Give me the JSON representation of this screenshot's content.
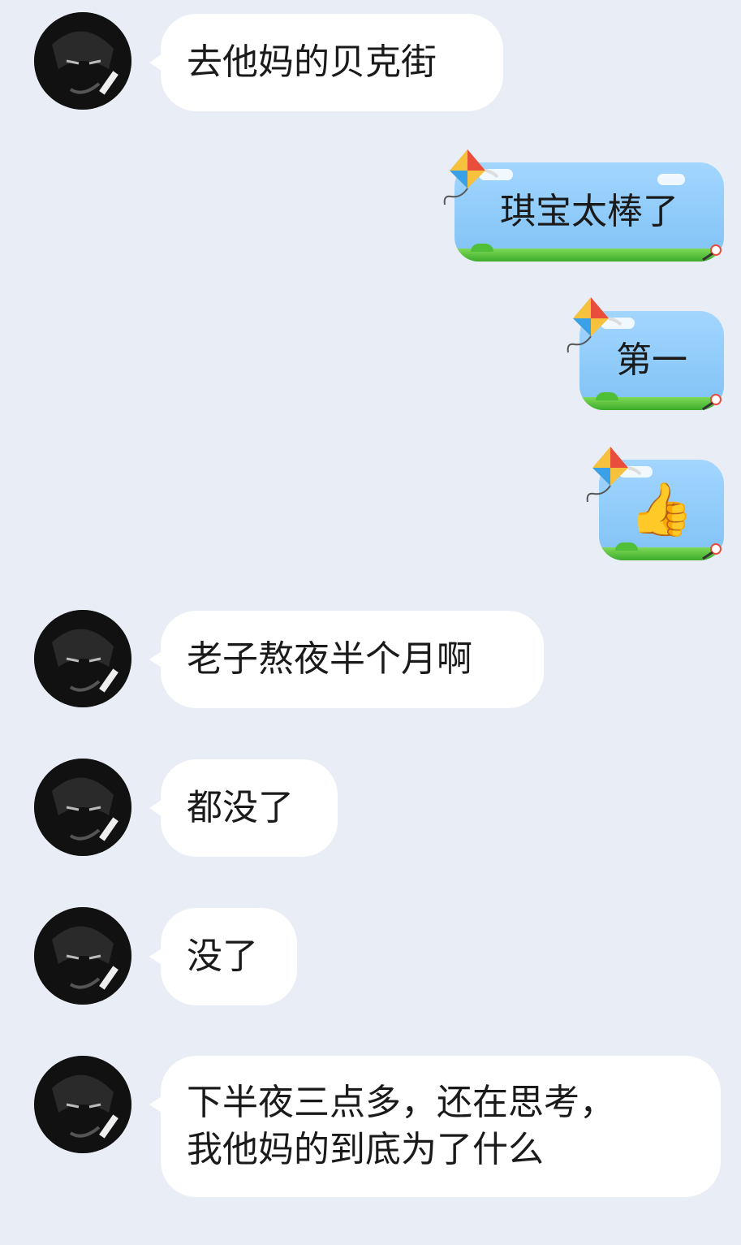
{
  "colors": {
    "background": "#e9edf5",
    "incoming_bubble": "#ffffff",
    "outgoing_bubble_sky": "#8fcbf7",
    "outgoing_bubble_grass": "#3cab2a"
  },
  "messages": [
    {
      "side": "incoming",
      "text": "去他妈的贝克街"
    },
    {
      "side": "outgoing",
      "text": "琪宝太棒了"
    },
    {
      "side": "outgoing",
      "text": "第一"
    },
    {
      "side": "outgoing",
      "text": "👍",
      "icon": "thumbs-up-icon"
    },
    {
      "side": "incoming",
      "text": "老子熬夜半个月啊"
    },
    {
      "side": "incoming",
      "text": "都没了"
    },
    {
      "side": "incoming",
      "text": "没了"
    },
    {
      "side": "incoming",
      "lines": [
        "下半夜三点多，还在思考，",
        "我他妈的到底为了什么"
      ]
    }
  ]
}
